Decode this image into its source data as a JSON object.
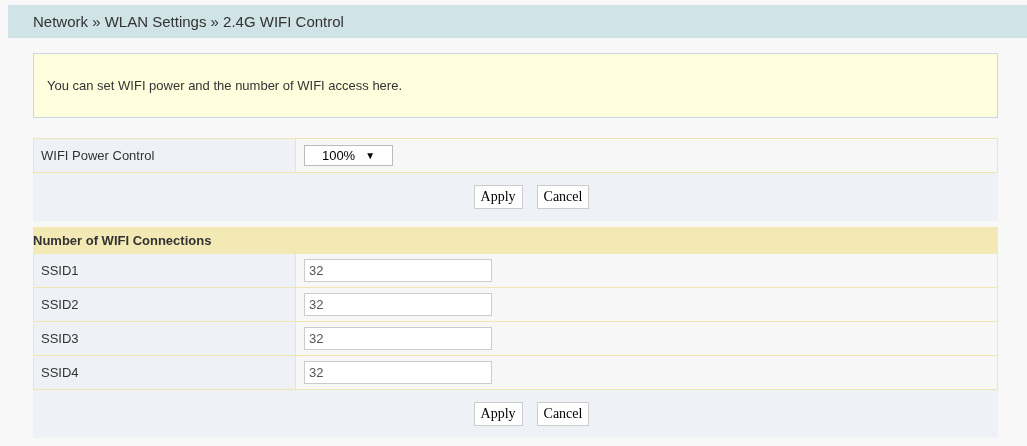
{
  "breadcrumb": "Network » WLAN Settings » 2.4G WIFI Control",
  "info": "You can set WIFI power and the number of WIFI access here.",
  "power": {
    "label": "WIFI Power Control",
    "value": "100%",
    "arrow": "▼",
    "buttons": [
      "Apply",
      "Cancel"
    ]
  },
  "connections": {
    "title": "Number of WIFI Connections",
    "rows": [
      {
        "label": "SSID1",
        "value": "32"
      },
      {
        "label": "SSID2",
        "value": "32"
      },
      {
        "label": "SSID3",
        "value": "32"
      },
      {
        "label": "SSID4",
        "value": "32"
      }
    ],
    "buttons": [
      "Apply",
      "Cancel"
    ]
  }
}
